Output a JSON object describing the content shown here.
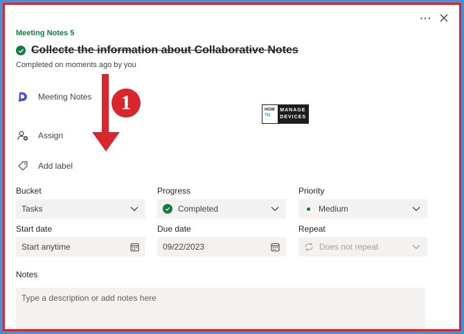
{
  "panel": {
    "more_icon": "more-horizontal-icon",
    "close_icon": "close-icon"
  },
  "task": {
    "plan_name": "Meeting Notes 5",
    "title": "Collecte the information about Collaborative Notes",
    "completed_text": "Completed on moments ago by you",
    "loop_link": "Meeting Notes",
    "assign_label": "Assign",
    "add_label": "Add label"
  },
  "annotation": {
    "step_number": "1"
  },
  "watermark": {
    "how": "HOW",
    "to": "TO",
    "manage": "MANAGE",
    "devices": "DEVICES"
  },
  "fields": {
    "bucket": {
      "label": "Bucket",
      "value": "Tasks"
    },
    "progress": {
      "label": "Progress",
      "value": "Completed"
    },
    "priority": {
      "label": "Priority",
      "value": "Medium"
    },
    "start_date": {
      "label": "Start date",
      "placeholder": "Start anytime"
    },
    "due_date": {
      "label": "Due date",
      "value": "09/22/2023"
    },
    "repeat": {
      "label": "Repeat",
      "value": "Does not repeat"
    },
    "notes": {
      "label": "Notes",
      "placeholder": "Type a description or add notes here"
    }
  },
  "colors": {
    "accent_green": "#107c41",
    "annotation_red": "#d9262c",
    "field_bg": "#f3f2f1",
    "background_blue": "#4a8fd6"
  }
}
